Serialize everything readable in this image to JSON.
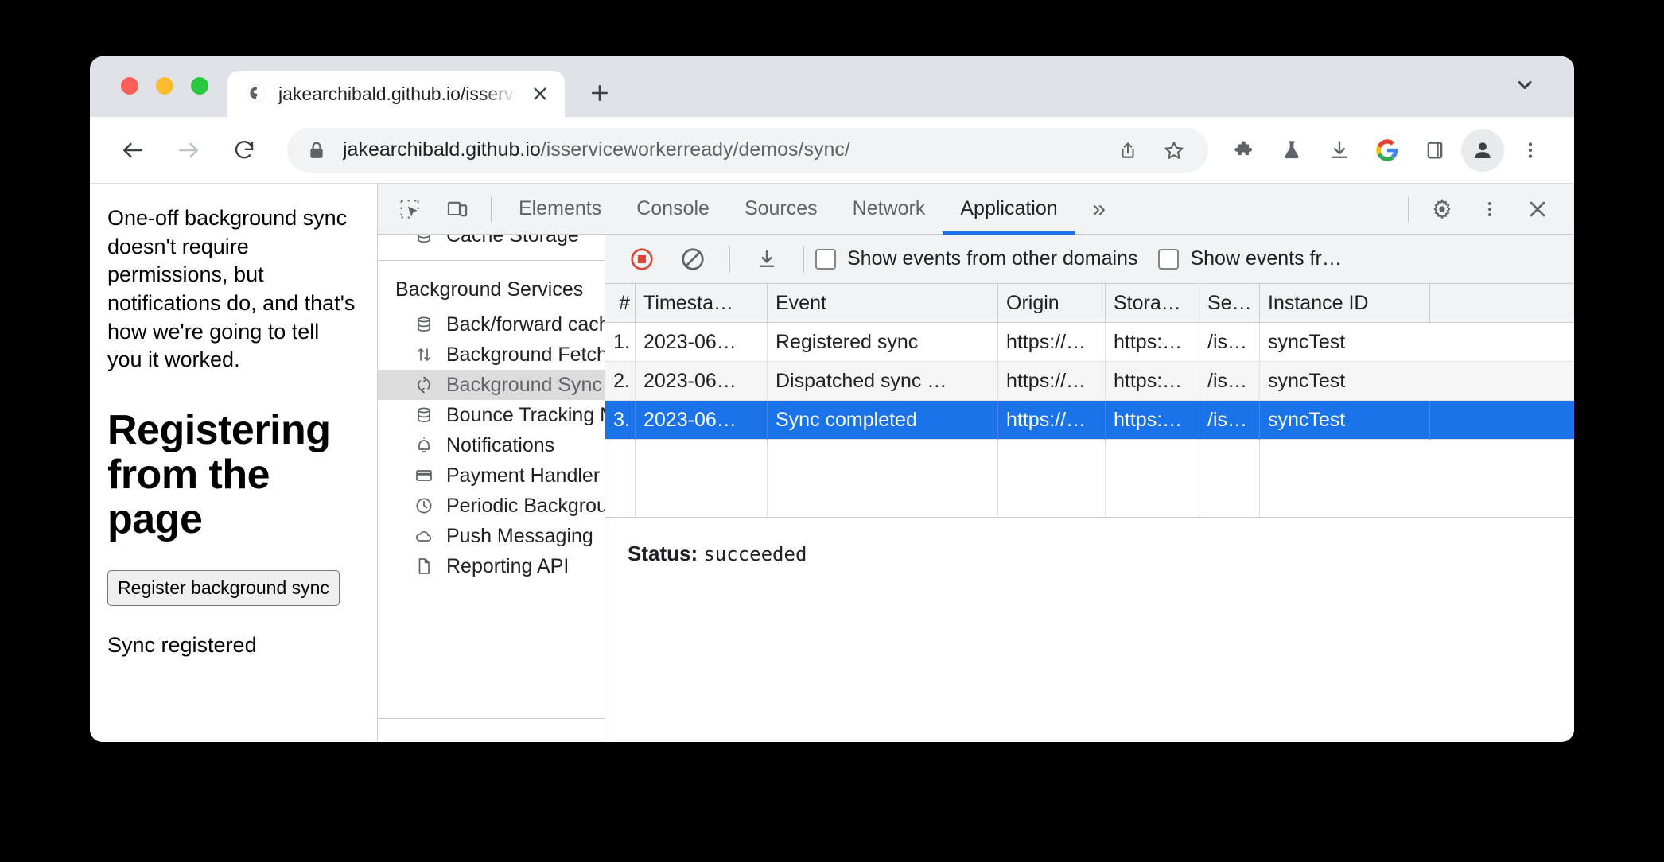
{
  "browser": {
    "tab": {
      "title": "jakearchibald.github.io/isservic",
      "favicon_icon": "globe-icon",
      "close_icon": "close-icon"
    },
    "new_tab_icon": "plus-icon",
    "tabstrip_chevron_icon": "chevron-down-icon",
    "toolbar": {
      "back_icon": "arrow-left-icon",
      "forward_icon": "arrow-right-icon",
      "reload_icon": "reload-icon",
      "lock_icon": "lock-icon",
      "url_domain": "jakearchibald.github.io",
      "url_path": "/isserviceworkerready/demos/sync/",
      "share_icon": "share-icon",
      "bookmark_icon": "star-icon",
      "extensions_icon": "puzzle-piece-icon",
      "experiments_icon": "flask-icon",
      "downloads_icon": "download-icon",
      "google_icon": "google-g-icon",
      "side_panel_icon": "side-panel-icon",
      "profile_icon": "avatar-icon",
      "menu_icon": "three-dot-menu-icon"
    }
  },
  "page": {
    "paragraph": "One-off background sync doesn't require permissions, but notifications do, and that's how we're going to tell you it worked.",
    "heading": "Registering from the page",
    "button_label": "Register background sync",
    "status": "Sync registered"
  },
  "devtools": {
    "inspect_icon": "inspect-element-icon",
    "device_toolbar_icon": "device-toolbar-icon",
    "tabs": [
      {
        "label": "Elements",
        "active": false
      },
      {
        "label": "Console",
        "active": false
      },
      {
        "label": "Sources",
        "active": false
      },
      {
        "label": "Network",
        "active": false
      },
      {
        "label": "Application",
        "active": true
      }
    ],
    "overflow_label": "»",
    "settings_icon": "gear-icon",
    "more_icon": "three-dot-menu-icon",
    "close_icon": "close-icon",
    "sidebar": {
      "section_title": "Background Services",
      "items": [
        {
          "label": "Back/forward cache",
          "icon": "database-icon",
          "selected": false
        },
        {
          "label": "Background Fetch",
          "icon": "arrows-up-down-icon",
          "selected": false
        },
        {
          "label": "Background Sync",
          "icon": "sync-icon",
          "selected": true
        },
        {
          "label": "Bounce Tracking Mitigations",
          "icon": "database-icon",
          "selected": false
        },
        {
          "label": "Notifications",
          "icon": "bell-icon",
          "selected": false
        },
        {
          "label": "Payment Handler",
          "icon": "credit-card-icon",
          "selected": false
        },
        {
          "label": "Periodic Background Sync",
          "icon": "clock-icon",
          "selected": false
        },
        {
          "label": "Push Messaging",
          "icon": "cloud-icon",
          "selected": false
        },
        {
          "label": "Reporting API",
          "icon": "document-icon",
          "selected": false
        }
      ]
    },
    "background_services": {
      "toolbar": {
        "record_icon": "stop-recording-icon",
        "record_color": "#db4437",
        "clear_icon": "clear-icon",
        "save_icon": "download-icon",
        "checkbox1_label": "Show events from other domains",
        "checkbox1_checked": false,
        "checkbox2_label": "Show events fr…",
        "checkbox2_checked": false
      },
      "columns": [
        "#",
        "Timesta…",
        "Event",
        "Origin",
        "Stora…",
        "Se…",
        "Instance ID"
      ],
      "rows": [
        {
          "num": "1.",
          "timestamp": "2023-06…",
          "event": "Registered sync",
          "origin": "https://…",
          "storage": "https:…",
          "sw": "/is…",
          "instance_id": "syncTest",
          "selected": false
        },
        {
          "num": "2.",
          "timestamp": "2023-06…",
          "event": "Dispatched sync …",
          "origin": "https://…",
          "storage": "https:…",
          "sw": "/is…",
          "instance_id": "syncTest",
          "selected": false
        },
        {
          "num": "3.",
          "timestamp": "2023-06…",
          "event": "Sync completed",
          "origin": "https://…",
          "storage": "https:…",
          "sw": "/is…",
          "instance_id": "syncTest",
          "selected": true
        }
      ],
      "detail": {
        "status_label": "Status:",
        "status_value": "succeeded"
      }
    }
  },
  "colors": {
    "accent": "#1a73e8",
    "record_red": "#db4437",
    "tabstrip": "#dee1e6",
    "panel_bg": "#f1f3f4"
  }
}
